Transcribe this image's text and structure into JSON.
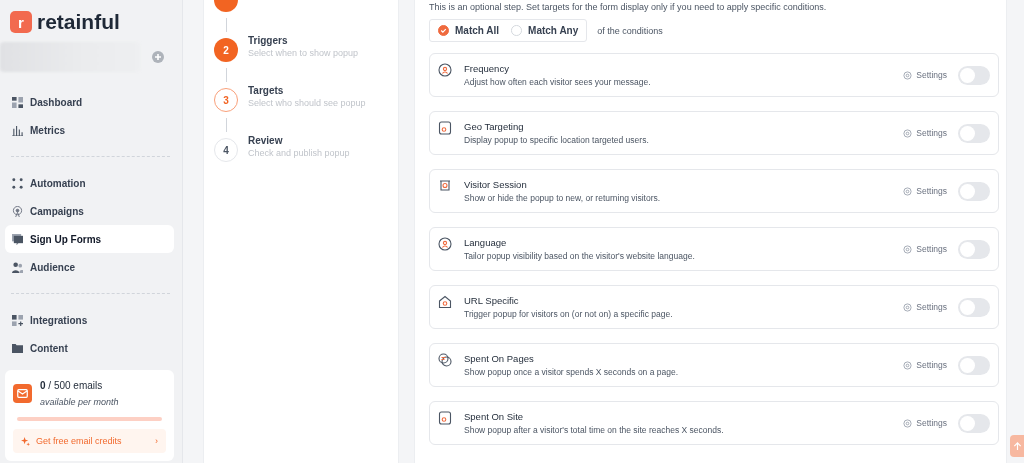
{
  "sidebar": {
    "logo": {
      "letter": "r",
      "name": "retainful"
    },
    "items": [
      {
        "label": "Dashboard",
        "selected": false
      },
      {
        "label": "Metrics",
        "selected": false
      },
      {
        "label": "Automation",
        "selected": false
      },
      {
        "label": "Campaigns",
        "selected": false
      },
      {
        "label": "Sign Up Forms",
        "selected": true
      },
      {
        "label": "Audience",
        "selected": false
      },
      {
        "label": "Integrations",
        "selected": false
      },
      {
        "label": "Content",
        "selected": false
      }
    ],
    "credits": {
      "level": 0,
      "count": "**0** / 500 emails",
      "period": "available per month",
      "link": "Get free email credits",
      "chevron": "›"
    }
  },
  "steps": [
    {
      "number": "2",
      "title": "Triggers",
      "description": "Select when to show popup",
      "completed": true,
      "selected": false
    },
    {
      "number": "3",
      "title": "Targets",
      "description": "Select who should see popup",
      "completed": false,
      "selected": true
    },
    {
      "number": "4",
      "title": "Review",
      "description": "Check and publish popup",
      "completed": false,
      "selected": false
    }
  ],
  "intro": "This is an optional step. Set targets for the form display only if you need to apply specific conditions.",
  "match": {
    "options": [
      {
        "label": "Match All",
        "selected": true
      },
      {
        "label": "Match Any",
        "selected": false
      }
    ],
    "suffix": "of the conditions"
  },
  "conditions": [
    {
      "title": "Frequency",
      "description": "Adjust how often each visitor sees your message.",
      "settings": "Settings",
      "on": false
    },
    {
      "title": "Geo Targeting",
      "description": "Display popup to specific location targeted users.",
      "settings": "Settings",
      "on": false
    },
    {
      "title": "Visitor Session",
      "description": "Show or hide the popup to new, or returning visitors.",
      "settings": "Settings",
      "on": false
    },
    {
      "title": "Language",
      "description": "Tailor popup visibility based on the visitor's website language.",
      "settings": "Settings",
      "on": false
    },
    {
      "title": "URL Specific",
      "description": "Trigger popup for visitors on (or not on) a specific page.",
      "settings": "Settings",
      "on": false
    },
    {
      "title": "Spent On Pages",
      "description": "Show popup once a visitor spends X seconds on a page.",
      "settings": "Settings",
      "on": false
    },
    {
      "title": "Spent On Site",
      "description": "Show popup after a visitor's total time on the site reaches X seconds.",
      "settings": "Settings",
      "on": false
    }
  ]
}
